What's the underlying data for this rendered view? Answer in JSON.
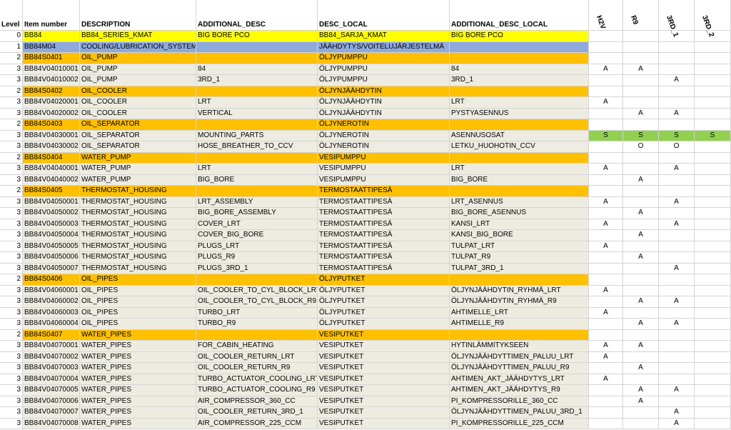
{
  "colors": {
    "lvl0": "#ffff00",
    "lvl1": "#8eaadb",
    "lvl2": "#ffc000",
    "lvl3": "#eeece1",
    "green": "#92d050",
    "grid": "#d4d4d4"
  },
  "headers": [
    "Level",
    "Item number",
    "DESCRIPTION",
    "ADDITIONAL_DESC",
    "DESC_LOCAL",
    "ADDITIONAL_DESC_LOCAL",
    "H2V",
    "R9",
    "3RD_1",
    "3RD_2"
  ],
  "rows": [
    {
      "level": "0",
      "item": "BB84",
      "desc": "BB84_SERIES_KMAT",
      "add": "BIG BORE PCO",
      "local": "BB84_SARJA_KMAT",
      "addlocal": "BIG BORE PCO",
      "h2v": "",
      "r9": "",
      "r1": "",
      "r2": ""
    },
    {
      "level": "1",
      "item": "BB84M04",
      "desc": "COOLING/LUBRICATION_SYSTEM",
      "add": "",
      "local": "JÄÄHDYTYS/VOITELUJÄRJESTELMÄ",
      "addlocal": "",
      "h2v": "",
      "r9": "",
      "r1": "",
      "r2": ""
    },
    {
      "level": "2",
      "item": "BB84S0401",
      "desc": "OIL_PUMP",
      "add": "",
      "local": "ÖLJYPUMPPU",
      "addlocal": "",
      "h2v": "",
      "r9": "",
      "r1": "",
      "r2": ""
    },
    {
      "level": "3",
      "item": "BB84V04010001",
      "desc": "OIL_PUMP",
      "add": "84",
      "local": "ÖLJYPUMPPU",
      "addlocal": "84",
      "h2v": "A",
      "r9": "A",
      "r1": "",
      "r2": ""
    },
    {
      "level": "3",
      "item": "BB84V04010002",
      "desc": "OIL_PUMP",
      "add": "3RD_1",
      "local": "ÖLJYPUMPPU",
      "addlocal": "3RD_1",
      "h2v": "",
      "r9": "",
      "r1": "A",
      "r2": ""
    },
    {
      "level": "2",
      "item": "BB84S0402",
      "desc": "OIL_COOLER",
      "add": "",
      "local": "ÖLJYNJÄÄHDYTIN",
      "addlocal": "",
      "h2v": "",
      "r9": "",
      "r1": "",
      "r2": ""
    },
    {
      "level": "3",
      "item": "BB84V04020001",
      "desc": "OIL_COOLER",
      "add": "LRT",
      "local": "ÖLJYNJÄÄHDYTIN",
      "addlocal": "LRT",
      "h2v": "A",
      "r9": "",
      "r1": "",
      "r2": ""
    },
    {
      "level": "3",
      "item": "BB84V04020002",
      "desc": "OIL_COOLER",
      "add": "VERTICAL",
      "local": "ÖLJYNJÄÄHDYTIN",
      "addlocal": "PYSTYASENNUS",
      "h2v": "",
      "r9": "A",
      "r1": "A",
      "r2": ""
    },
    {
      "level": "2",
      "item": "BB84S0403",
      "desc": "OIL_SEPARATOR",
      "add": "",
      "local": "ÖLJYNEROTIN",
      "addlocal": "",
      "h2v": "",
      "r9": "",
      "r1": "",
      "r2": ""
    },
    {
      "level": "3",
      "item": "BB84V04030001",
      "desc": "OIL_SEPARATOR",
      "add": "MOUNTING_PARTS",
      "local": "ÖLJYNEROTIN",
      "addlocal": "ASENNUSOSAT",
      "h2v": "S",
      "r9": "S",
      "r1": "S",
      "r2": "S",
      "green": true
    },
    {
      "level": "3",
      "item": "BB84V04030002",
      "desc": "OIL_SEPARATOR",
      "add": "HOSE_BREATHER_TO_CCV",
      "local": "ÖLJYNEROTIN",
      "addlocal": "LETKU_HUOHOTIN_CCV",
      "h2v": "",
      "r9": "O",
      "r1": "O",
      "r2": ""
    },
    {
      "level": "2",
      "item": "BB84S0404",
      "desc": "WATER_PUMP",
      "add": "",
      "local": "VESIPUMPPU",
      "addlocal": "",
      "h2v": "",
      "r9": "",
      "r1": "",
      "r2": ""
    },
    {
      "level": "3",
      "item": "BB84V04040001",
      "desc": "WATER_PUMP",
      "add": "LRT",
      "local": "VESIPUMPPU",
      "addlocal": "LRT",
      "h2v": "A",
      "r9": "",
      "r1": "A",
      "r2": ""
    },
    {
      "level": "3",
      "item": "BB84V04040002",
      "desc": "WATER_PUMP",
      "add": "BIG_BORE",
      "local": "VESIPUMPPU",
      "addlocal": "BIG_BORE",
      "h2v": "",
      "r9": "A",
      "r1": "",
      "r2": ""
    },
    {
      "level": "2",
      "item": "BB84S0405",
      "desc": "THERMOSTAT_HOUSING",
      "add": "",
      "local": "TERMOSTAATTIPESÄ",
      "addlocal": "",
      "h2v": "",
      "r9": "",
      "r1": "",
      "r2": ""
    },
    {
      "level": "3",
      "item": "BB84V04050001",
      "desc": "THERMOSTAT_HOUSING",
      "add": "LRT_ASSEMBLY",
      "local": "TERMOSTAATTIPESÄ",
      "addlocal": "LRT_ASENNUS",
      "h2v": "A",
      "r9": "",
      "r1": "A",
      "r2": ""
    },
    {
      "level": "3",
      "item": "BB84V04050002",
      "desc": "THERMOSTAT_HOUSING",
      "add": "BIG_BORE_ASSEMBLY",
      "local": "TERMOSTAATTIPESÄ",
      "addlocal": "BIG_BORE_ASENNUS",
      "h2v": "",
      "r9": "A",
      "r1": "",
      "r2": ""
    },
    {
      "level": "3",
      "item": "BB84V04050003",
      "desc": "THERMOSTAT_HOUSING",
      "add": "COVER_LRT",
      "local": "TERMOSTAATTIPESÄ",
      "addlocal": "KANSI_LRT",
      "h2v": "A",
      "r9": "",
      "r1": "A",
      "r2": ""
    },
    {
      "level": "3",
      "item": "BB84V04050004",
      "desc": "THERMOSTAT_HOUSING",
      "add": "COVER_BIG_BORE",
      "local": "TERMOSTAATTIPESÄ",
      "addlocal": "KANSI_BIG_BORE",
      "h2v": "",
      "r9": "A",
      "r1": "",
      "r2": ""
    },
    {
      "level": "3",
      "item": "BB84V04050005",
      "desc": "THERMOSTAT_HOUSING",
      "add": "PLUGS_LRT",
      "local": "TERMOSTAATTIPESÄ",
      "addlocal": "TULPAT_LRT",
      "h2v": "A",
      "r9": "",
      "r1": "",
      "r2": ""
    },
    {
      "level": "3",
      "item": "BB84V04050006",
      "desc": "THERMOSTAT_HOUSING",
      "add": "PLUGS_R9",
      "local": "TERMOSTAATTIPESÄ",
      "addlocal": "TULPAT_R9",
      "h2v": "",
      "r9": "A",
      "r1": "",
      "r2": ""
    },
    {
      "level": "3",
      "item": "BB84V04050007",
      "desc": "THERMOSTAT_HOUSING",
      "add": "PLUGS_3RD_1",
      "local": "TERMOSTAATTIPESÄ",
      "addlocal": "TULPAT_3RD_1",
      "h2v": "",
      "r9": "",
      "r1": "A",
      "r2": ""
    },
    {
      "level": "2",
      "item": "BB84S0406",
      "desc": "OIL_PIPES",
      "add": "",
      "local": "ÖLJYPUTKET",
      "addlocal": "",
      "h2v": "",
      "r9": "",
      "r1": "",
      "r2": ""
    },
    {
      "level": "3",
      "item": "BB84V04060001",
      "desc": "OIL_PIPES",
      "add": "OIL_COOLER_TO_CYL_BLOCK_LRT",
      "local": "ÖLJYPUTKET",
      "addlocal": "ÖLJYNJÄÄHDYTIN_RYHMÄ_LRT",
      "h2v": "A",
      "r9": "",
      "r1": "",
      "r2": ""
    },
    {
      "level": "3",
      "item": "BB84V04060002",
      "desc": "OIL_PIPES",
      "add": "OIL_COOLER_TO_CYL_BLOCK_R9",
      "local": "ÖLJYPUTKET",
      "addlocal": "ÖLJYNJÄÄHDYTIN_RYHMÄ_R9",
      "h2v": "",
      "r9": "A",
      "r1": "A",
      "r2": ""
    },
    {
      "level": "3",
      "item": "BB84V04060003",
      "desc": "OIL_PIPES",
      "add": "TURBO_LRT",
      "local": "ÖLJYPUTKET",
      "addlocal": "AHTIMELLE_LRT",
      "h2v": "A",
      "r9": "",
      "r1": "",
      "r2": ""
    },
    {
      "level": "3",
      "item": "BB84V04060004",
      "desc": "OIL_PIPES",
      "add": "TURBO_R9",
      "local": "ÖLJYPUTKET",
      "addlocal": "AHTIMELLE_R9",
      "h2v": "",
      "r9": "A",
      "r1": "A",
      "r2": ""
    },
    {
      "level": "2",
      "item": "BB84S0407",
      "desc": "WATER_PIPES",
      "add": "",
      "local": "VESIPUTKET",
      "addlocal": "",
      "h2v": "",
      "r9": "",
      "r1": "",
      "r2": ""
    },
    {
      "level": "3",
      "item": "BB84V04070001",
      "desc": "WATER_PIPES",
      "add": "FOR_CABIN_HEATING",
      "local": "VESIPUTKET",
      "addlocal": "HYTINLÄMMITYKSEEN",
      "h2v": "A",
      "r9": "A",
      "r1": "",
      "r2": ""
    },
    {
      "level": "3",
      "item": "BB84V04070002",
      "desc": "WATER_PIPES",
      "add": "OIL_COOLER_RETURN_LRT",
      "local": "VESIPUTKET",
      "addlocal": "ÖLJYNJÄÄHDYTTIMEN_PALUU_LRT",
      "h2v": "A",
      "r9": "",
      "r1": "",
      "r2": ""
    },
    {
      "level": "3",
      "item": "BB84V04070003",
      "desc": "WATER_PIPES",
      "add": "OIL_COOLER_RETURN_R9",
      "local": "VESIPUTKET",
      "addlocal": "ÖLJYNJÄÄHDYTTIMEN_PALUU_R9",
      "h2v": "",
      "r9": "A",
      "r1": "",
      "r2": ""
    },
    {
      "level": "3",
      "item": "BB84V04070004",
      "desc": "WATER_PIPES",
      "add": "TURBO_ACTUATOR_COOLING_LRT",
      "local": "VESIPUTKET",
      "addlocal": "AHTIMEN_AKT_JÄÄHDYTYS_LRT",
      "h2v": "A",
      "r9": "",
      "r1": "",
      "r2": ""
    },
    {
      "level": "3",
      "item": "BB84V04070005",
      "desc": "WATER_PIPES",
      "add": "TURBO_ACTUATOR_COOLING_R9",
      "local": "VESIPUTKET",
      "addlocal": "AHTIMEN_AKT_JÄÄHDYTYS_R9",
      "h2v": "",
      "r9": "A",
      "r1": "A",
      "r2": ""
    },
    {
      "level": "3",
      "item": "BB84V04070006",
      "desc": "WATER_PIPES",
      "add": "AIR_COMPRESSOR_360_CC",
      "local": "VESIPUTKET",
      "addlocal": "PI_KOMPRESSORILLE_360_CC",
      "h2v": "",
      "r9": "A",
      "r1": "",
      "r2": ""
    },
    {
      "level": "3",
      "item": "BB84V04070007",
      "desc": "WATER_PIPES",
      "add": "OIL_COOLER_RETURN_3RD_1",
      "local": "VESIPUTKET",
      "addlocal": "ÖLJYNJÄÄHDYTTIMEN_PALUU_3RD_1",
      "h2v": "",
      "r9": "",
      "r1": "A",
      "r2": ""
    },
    {
      "level": "3",
      "item": "BB84V04070008",
      "desc": "WATER_PIPES",
      "add": "AIR_COMPRESSOR_225_CCM",
      "local": "VESIPUTKET",
      "addlocal": "PI_KOMPRESSORILLE_225_CCM",
      "h2v": "",
      "r9": "",
      "r1": "A",
      "r2": ""
    }
  ]
}
